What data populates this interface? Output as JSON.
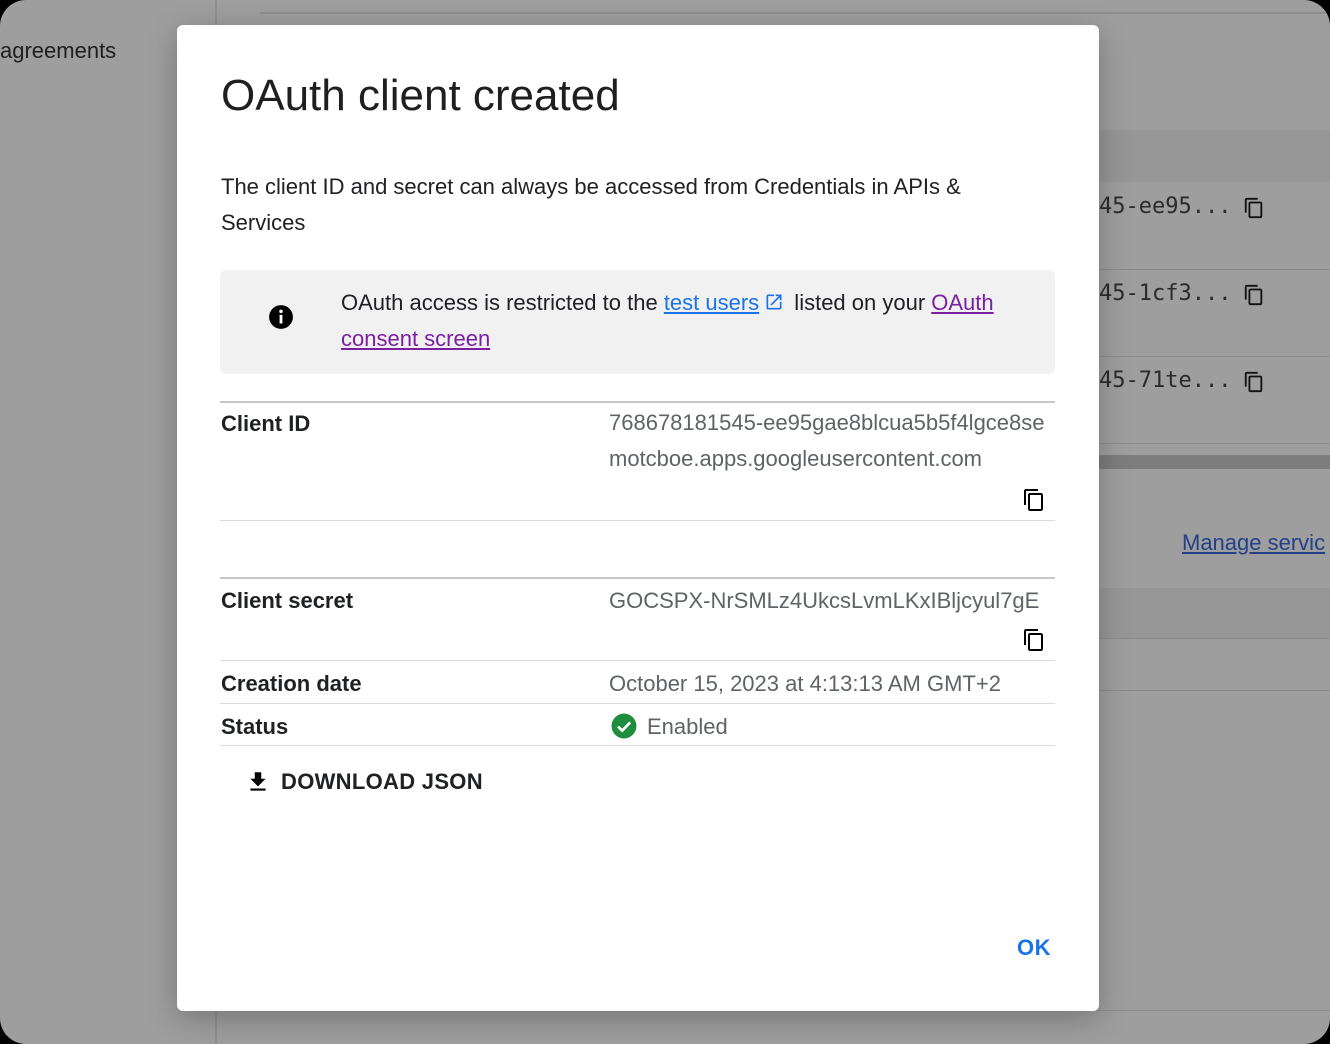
{
  "background": {
    "sidebar_item": "agreements",
    "rows": [
      {
        "text": "45-ee95..."
      },
      {
        "text": "45-1cf3..."
      },
      {
        "text": "45-71te..."
      }
    ],
    "manage_link": "Manage servic"
  },
  "dialog": {
    "title": "OAuth client created",
    "description": "The client ID and secret can always be accessed from Credentials in APIs & Services",
    "info": {
      "text_before": "OAuth access is restricted to the ",
      "test_users_link": "test users",
      "text_middle": " listed on your ",
      "consent_link": "OAuth consent screen"
    },
    "fields": {
      "client_id_label": "Client ID",
      "client_id_value": "768678181545-ee95gae8blcua5b5f4lgce8semotcboe.apps.googleusercontent.com",
      "client_secret_label": "Client secret",
      "client_secret_value": "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",
      "creation_date_label": "Creation date",
      "creation_date_value": "October 15, 2023 at 4:13:13 AM GMT+2",
      "status_label": "Status",
      "status_value": "Enabled"
    },
    "download_label": "DOWNLOAD JSON",
    "ok_label": "OK"
  },
  "colors": {
    "link_blue": "#1a73e8",
    "link_visited": "#7b1fa2",
    "status_green": "#1e8e3e",
    "overlay": "#9e9e9e"
  },
  "icons": [
    "info-icon",
    "external-link-icon",
    "copy-icon",
    "check-circle-icon",
    "download-icon"
  ]
}
